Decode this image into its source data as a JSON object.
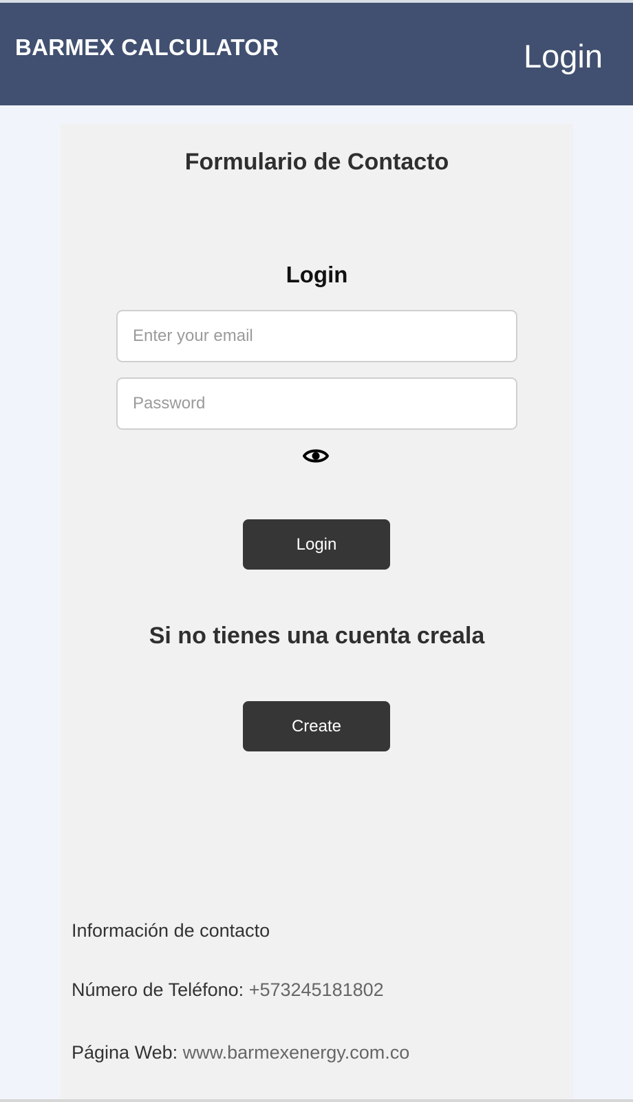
{
  "header": {
    "brand": "BARMEX CALCULATOR",
    "nav_login": "Login"
  },
  "form": {
    "title": "Formulario de Contacto",
    "login_heading": "Login",
    "email_placeholder": "Enter your email",
    "password_placeholder": "Password",
    "toggle_icon": "eye-icon",
    "login_button": "Login",
    "signup_prompt": "Si no tienes una cuenta creala",
    "create_button": "Create"
  },
  "contact": {
    "title": "Información de contacto",
    "phone_label": "Número de Teléfono:",
    "phone_value": "+573245181802",
    "web_label": "Página Web:",
    "web_value": "www.barmexenergy.com.co"
  },
  "colors": {
    "header_bg": "#415070",
    "page_bg": "#f1f4fb",
    "card_bg": "#f1f1f1",
    "button_bg": "#363636"
  }
}
